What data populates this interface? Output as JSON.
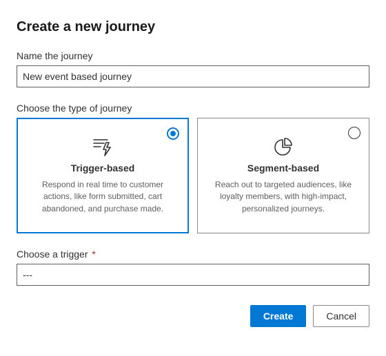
{
  "dialog": {
    "title": "Create a new journey"
  },
  "name_field": {
    "label": "Name the journey",
    "value": "New event based journey"
  },
  "type_field": {
    "label": "Choose the type of journey",
    "selected": "trigger",
    "options": {
      "trigger": {
        "title": "Trigger-based",
        "description": "Respond in real time to customer actions, like form submitted, cart abandoned, and purchase made."
      },
      "segment": {
        "title": "Segment-based",
        "description": "Reach out to targeted audiences, like loyalty members, with high-impact, personalized journeys."
      }
    }
  },
  "trigger_field": {
    "label": "Choose a trigger",
    "required_marker": "*",
    "value": "---"
  },
  "footer": {
    "create": "Create",
    "cancel": "Cancel"
  }
}
